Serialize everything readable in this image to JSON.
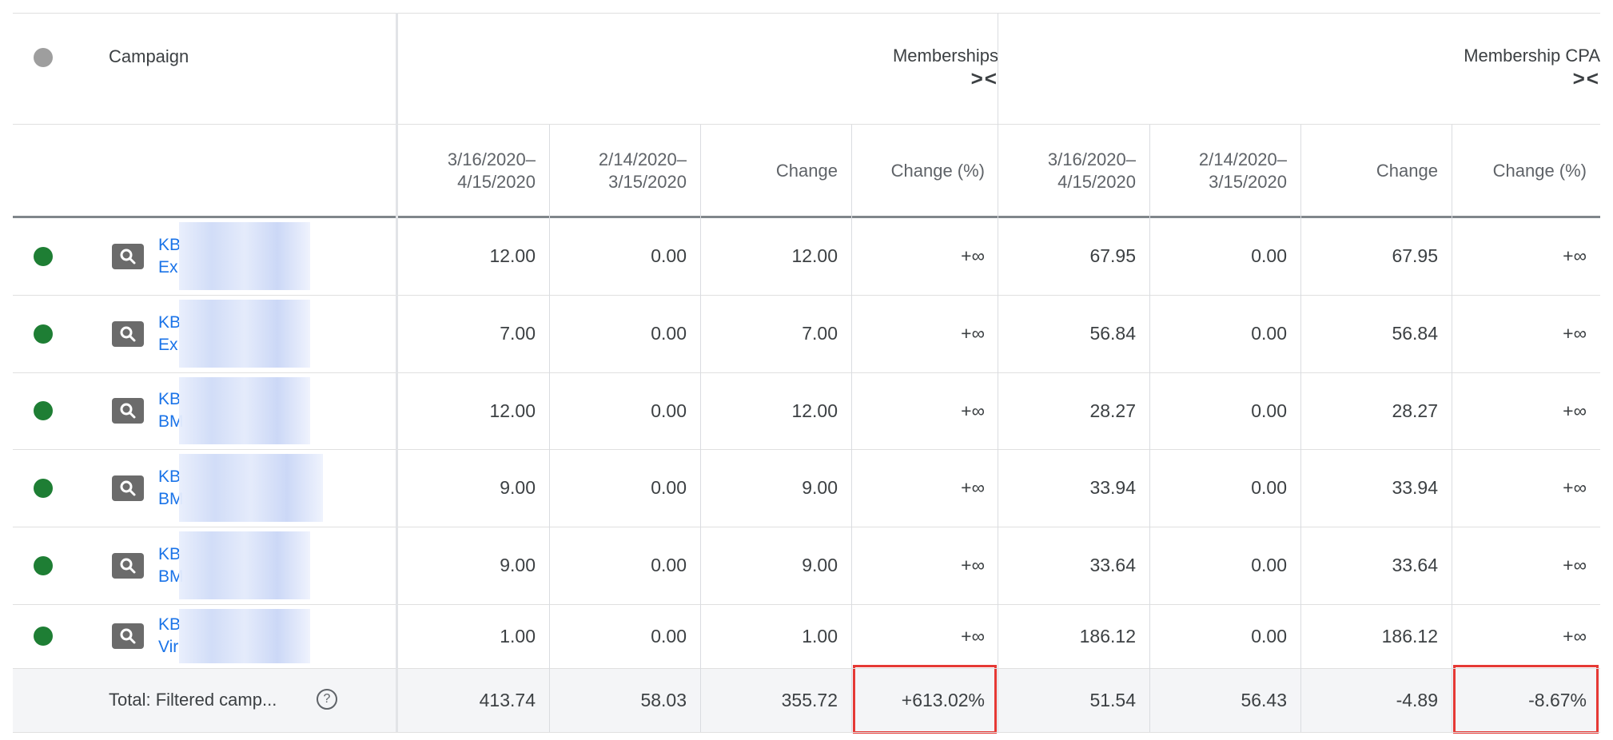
{
  "header": {
    "campaign_label": "Campaign",
    "memberships_label": "Memberships",
    "membership_cpa_label": "Membership CPA",
    "collapse_glyph": "><",
    "subcolumns": [
      "3/16/2020–\n4/15/2020",
      "2/14/2020–\n3/15/2020",
      "Change",
      "Change (%)",
      "3/16/2020–\n4/15/2020",
      "2/14/2020–\n3/15/2020",
      "Change",
      "Change (%)"
    ]
  },
  "rows": [
    {
      "name1": "KB",
      "name2": "Ex",
      "values": [
        "12.00",
        "0.00",
        "12.00",
        "+∞",
        "67.95",
        "0.00",
        "67.95",
        "+∞"
      ]
    },
    {
      "name1": "KB",
      "name2": "Ex",
      "values": [
        "7.00",
        "0.00",
        "7.00",
        "+∞",
        "56.84",
        "0.00",
        "56.84",
        "+∞"
      ]
    },
    {
      "name1": "KB",
      "name2": "BM",
      "values": [
        "12.00",
        "0.00",
        "12.00",
        "+∞",
        "28.27",
        "0.00",
        "28.27",
        "+∞"
      ]
    },
    {
      "name1": "KB",
      "name2": "BM",
      "values": [
        "9.00",
        "0.00",
        "9.00",
        "+∞",
        "33.94",
        "0.00",
        "33.94",
        "+∞"
      ]
    },
    {
      "name1": "KB",
      "name2": "BM",
      "values": [
        "9.00",
        "0.00",
        "9.00",
        "+∞",
        "33.64",
        "0.00",
        "33.64",
        "+∞"
      ]
    },
    {
      "name1": "KB",
      "name2": "Vir",
      "values": [
        "1.00",
        "0.00",
        "1.00",
        "+∞",
        "186.12",
        "0.00",
        "186.12",
        "+∞"
      ]
    }
  ],
  "total": {
    "label": "Total: Filtered camp...",
    "help_glyph": "?",
    "values": [
      "413.74",
      "58.03",
      "355.72",
      "+613.02%",
      "51.54",
      "56.43",
      "-4.89",
      "-8.67%"
    ]
  },
  "colors": {
    "status_enabled": "#1e7e34",
    "link": "#1a73e8",
    "highlight": "#e53935"
  }
}
